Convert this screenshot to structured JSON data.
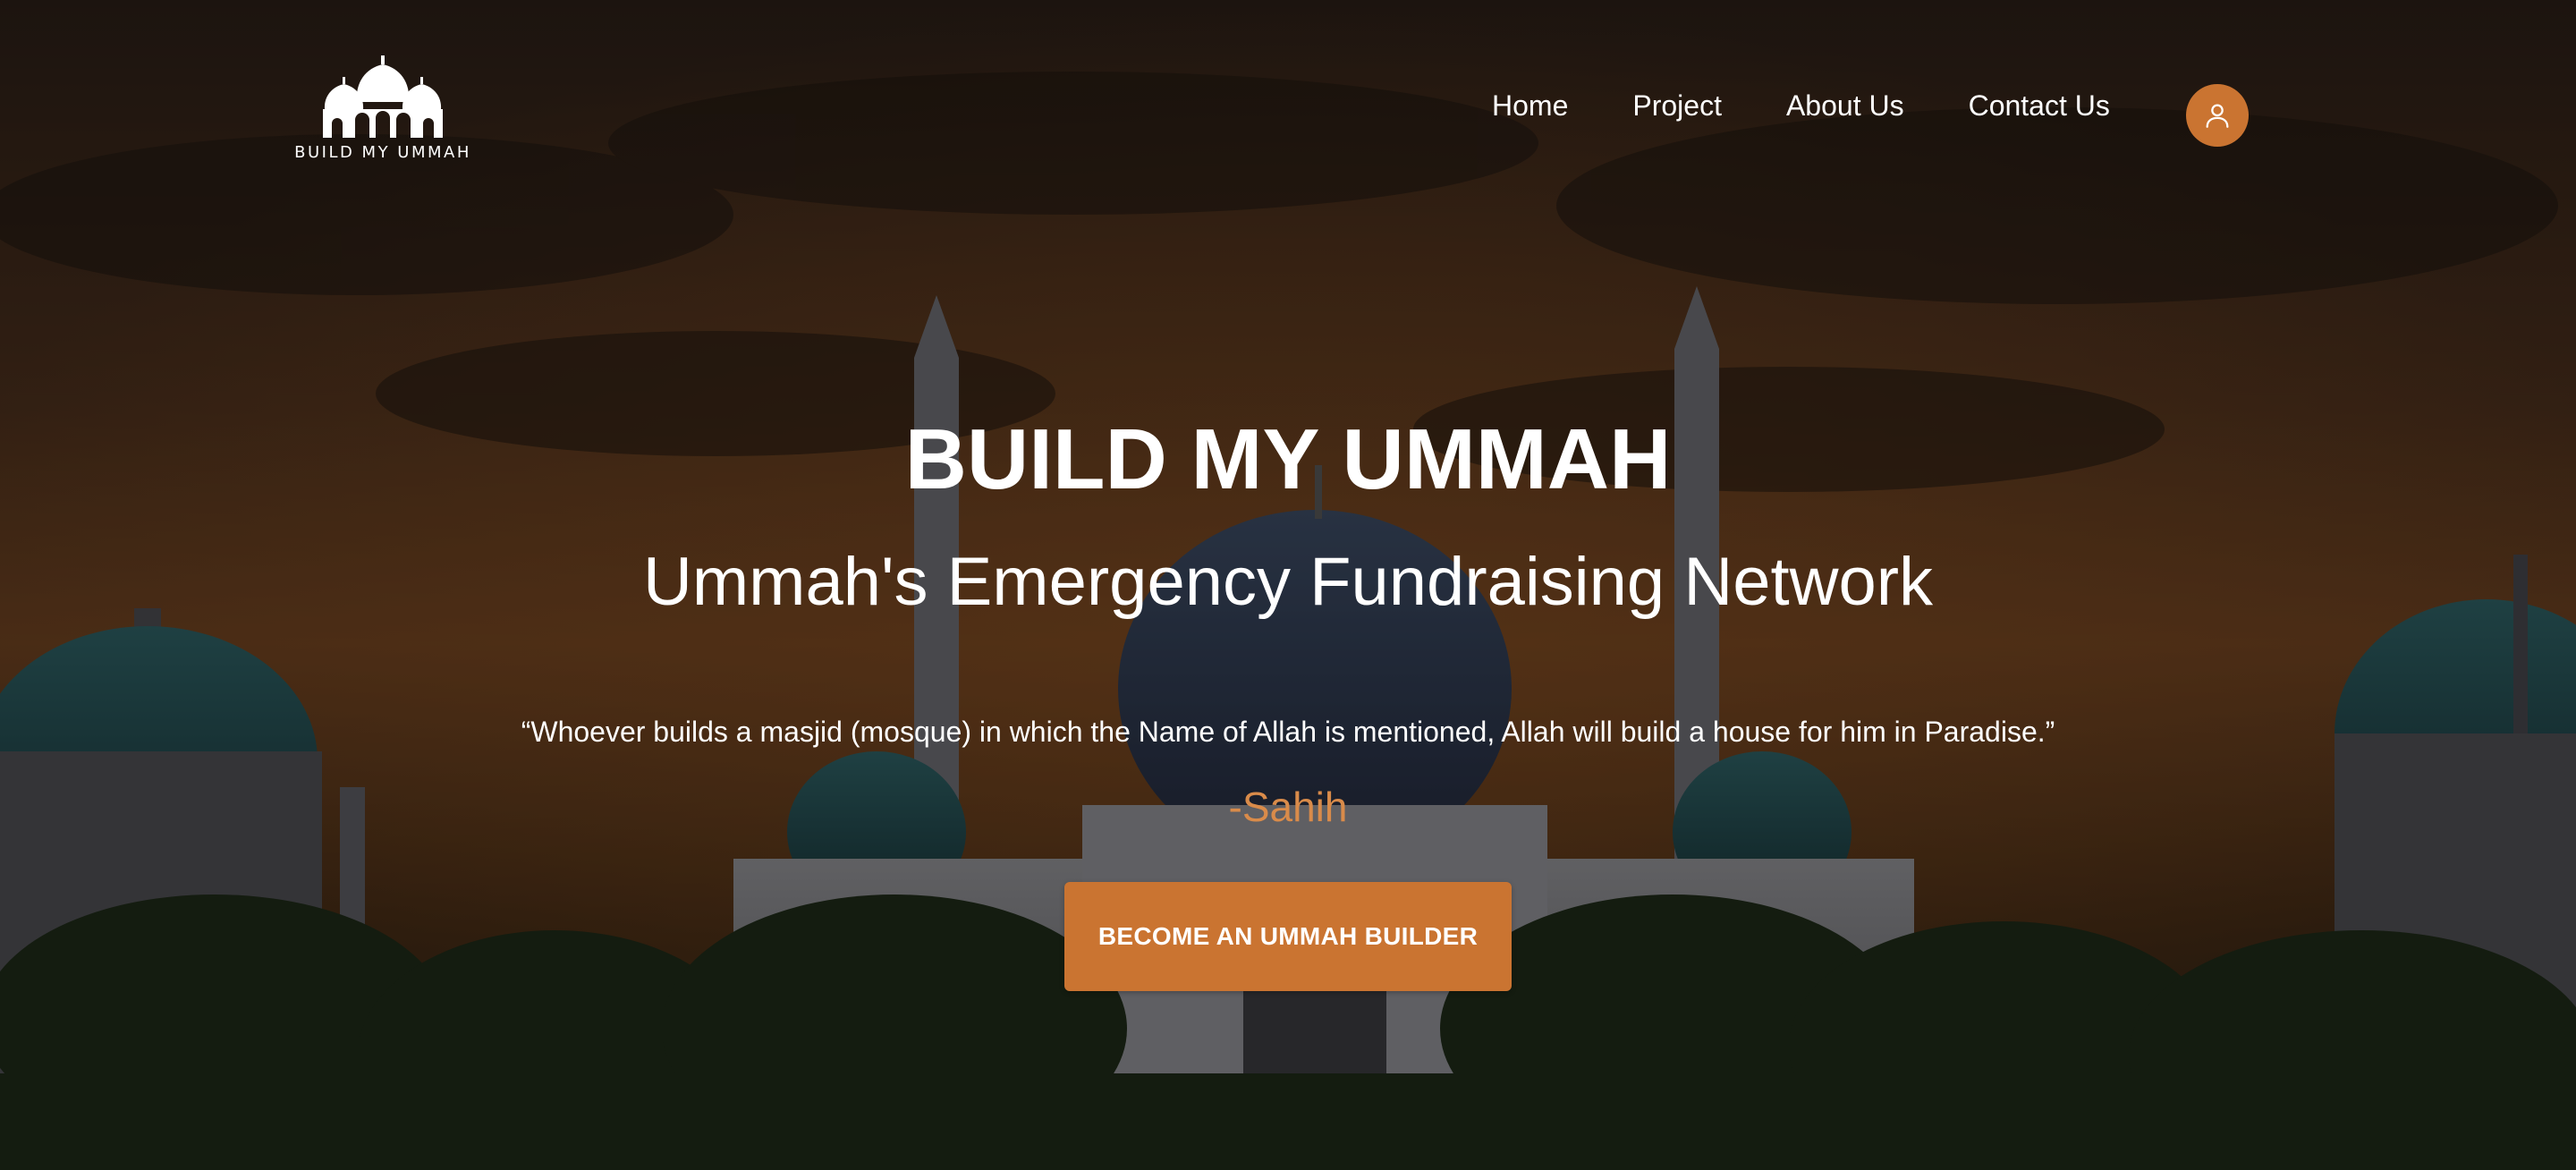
{
  "brand": {
    "name": "BUILD MY UMMAH",
    "logo_icon": "mosque-domes-icon"
  },
  "nav": {
    "items": [
      {
        "label": "Home"
      },
      {
        "label": "Project"
      },
      {
        "label": "About Us"
      },
      {
        "label": "Contact Us"
      }
    ],
    "user_icon": "user-icon"
  },
  "hero": {
    "title": "BUILD MY UMMAH",
    "subtitle": "Ummah's Emergency Fundraising Network",
    "quote": "“Whoever builds a masjid (mosque) in which the Name of Allah is mentioned, Allah will build a house for him in Paradise.”",
    "attribution": "-Sahih",
    "cta_label": "BECOME AN UMMAH BUILDER"
  },
  "colors": {
    "accent": "#ca7431",
    "attribution": "#d98b4a",
    "text": "#ffffff"
  }
}
